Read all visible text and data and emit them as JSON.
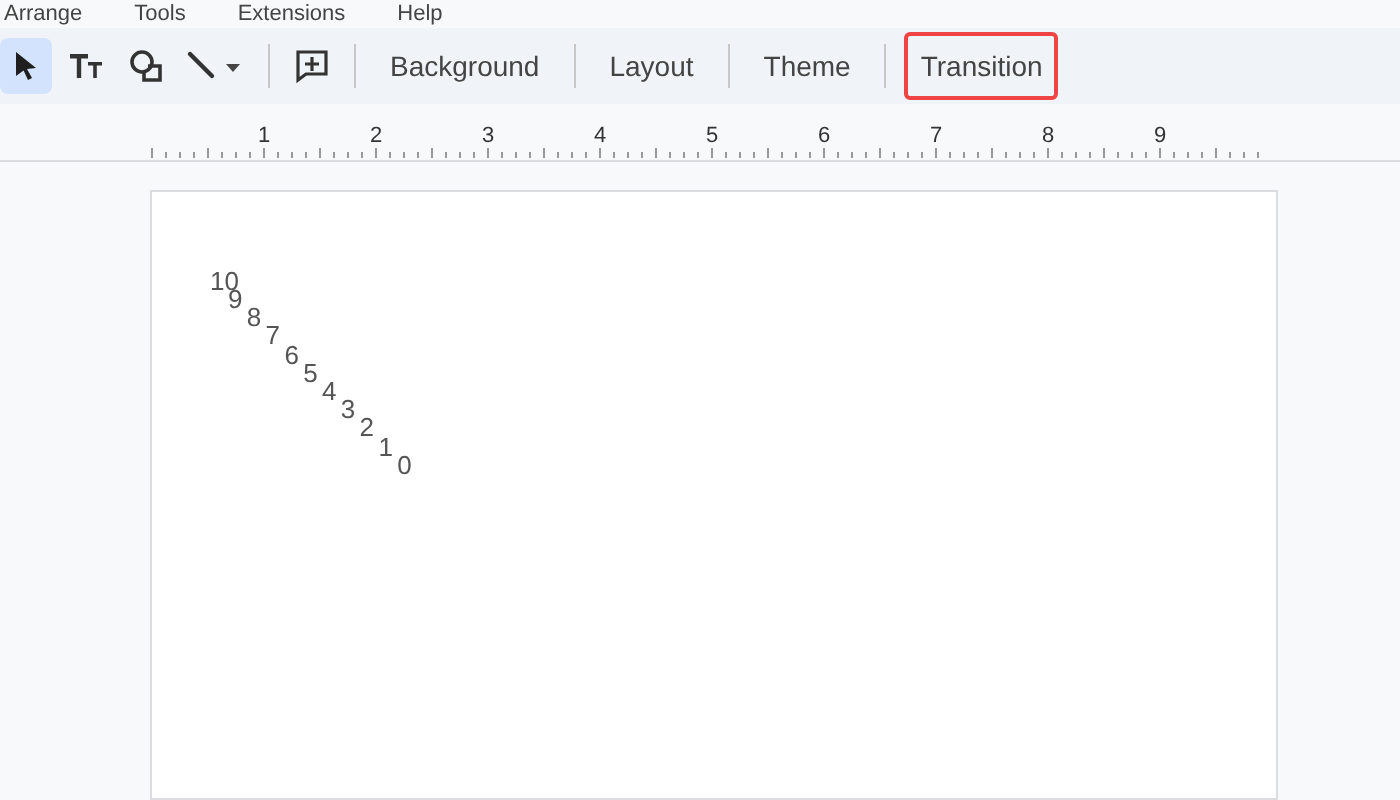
{
  "menu": [
    "Arrange",
    "Tools",
    "Extensions",
    "Help"
  ],
  "toolbar": {
    "tools": [
      {
        "kind": "select",
        "selected": true
      },
      {
        "kind": "text",
        "selected": false
      },
      {
        "kind": "shape",
        "selected": false
      },
      {
        "kind": "line",
        "selected": false
      },
      {
        "kind": "comment",
        "selected": false
      }
    ],
    "buttons": [
      {
        "label": "Background",
        "highlighted": false
      },
      {
        "label": "Layout",
        "highlighted": false
      },
      {
        "label": "Theme",
        "highlighted": false
      },
      {
        "label": "Transition",
        "highlighted": true
      }
    ]
  },
  "ruler": [
    "1",
    "2",
    "3",
    "4",
    "5",
    "6",
    "7",
    "8",
    "9"
  ],
  "slide": {
    "labels": [
      "10",
      "9",
      "8",
      "7",
      "6",
      "5",
      "4",
      "3",
      "2",
      "1",
      "0"
    ]
  }
}
